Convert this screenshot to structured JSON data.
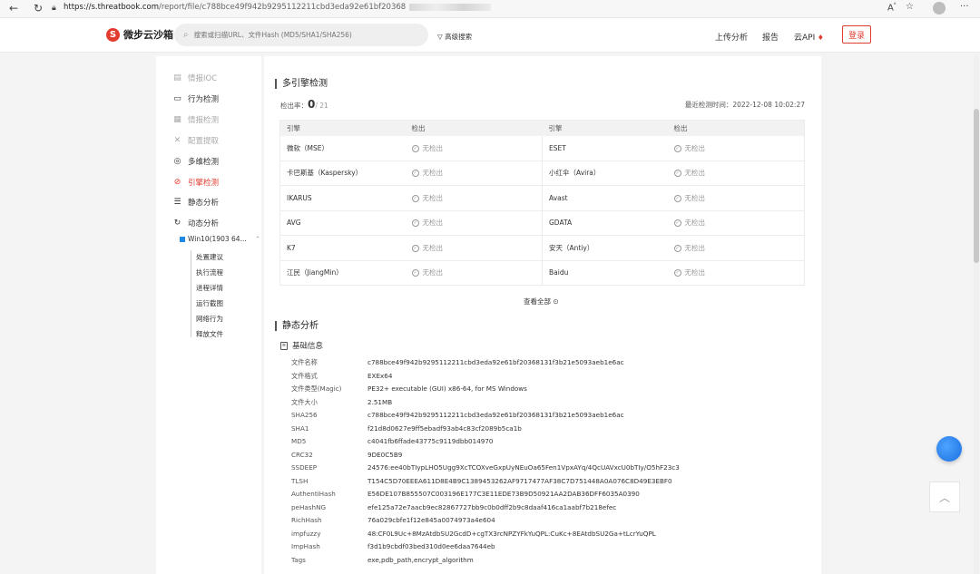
{
  "browser": {
    "back_icon": "back-arrow-icon",
    "refresh_icon": "refresh-icon",
    "url_host": "https://s.threatbook.com",
    "url_path": "/report/file/c788bce49f942b9295112211cbd3eda92e61bf20368",
    "read_aloud": "Aᴬ",
    "more": "···"
  },
  "topnav": {
    "logo_text": "微步云沙箱",
    "search_placeholder": "搜索或扫描URL、文件Hash (MD5/SHA1/SHA256)",
    "advanced_search": "高级搜索",
    "upload_analysis": "上传分析",
    "report": "报告",
    "cloud_api": "云API",
    "login": "登录"
  },
  "sidebar": {
    "items": [
      {
        "label": "情报IOC",
        "icon": "doc-icon"
      },
      {
        "label": "行为检测",
        "icon": "monitor-icon"
      },
      {
        "label": "情报检测",
        "icon": "grid-icon"
      },
      {
        "label": "配置提取",
        "icon": "tools-icon"
      },
      {
        "label": "多维检测",
        "icon": "layers-icon"
      },
      {
        "label": "引擎检测",
        "icon": "question-circle-icon"
      },
      {
        "label": "静态分析",
        "icon": "list-icon"
      },
      {
        "label": "动态分析",
        "icon": "refresh-icon"
      }
    ],
    "env_label": "Win10(1903 64...",
    "sub_items": [
      "处置建议",
      "执行流程",
      "进程详情",
      "运行截图",
      "网络行为",
      "释放文件"
    ]
  },
  "engines": {
    "section_title": "多引擎检测",
    "rate_label": "检出率：",
    "rate_value": "0",
    "rate_total": "/ 21",
    "last_scan": "最近检测时间：2022-12-08 10:02:27",
    "col_engine": "引擎",
    "col_detect": "检出",
    "rows": [
      {
        "e1": "微软（MSE）",
        "d1": "无检出",
        "e2": "ESET",
        "d2": "无检出"
      },
      {
        "e1": "卡巴斯基（Kaspersky）",
        "d1": "无检出",
        "e2": "小红伞（Avira）",
        "d2": "无检出"
      },
      {
        "e1": "IKARUS",
        "d1": "无检出",
        "e2": "Avast",
        "d2": "无检出"
      },
      {
        "e1": "AVG",
        "d1": "无检出",
        "e2": "GDATA",
        "d2": "无检出"
      },
      {
        "e1": "K7",
        "d1": "无检出",
        "e2": "安天（Antiy）",
        "d2": "无检出"
      },
      {
        "e1": "江民（JiangMin）",
        "d1": "无检出",
        "e2": "Baidu",
        "d2": "无检出"
      }
    ],
    "view_all": "查看全部"
  },
  "static": {
    "section_title": "静态分析",
    "basic_info_title": "基础信息",
    "rows": [
      {
        "k": "文件名称",
        "v": "c788bce49f942b9295112211cbd3eda92e61bf20368131f3b21e5093aeb1e6ac"
      },
      {
        "k": "文件格式",
        "v": "EXEx64"
      },
      {
        "k": "文件类型(Magic)",
        "v": "PE32+ executable (GUI) x86-64, for MS Windows"
      },
      {
        "k": "文件大小",
        "v": "2.51MB"
      },
      {
        "k": "SHA256",
        "v": "c788bce49f942b9295112211cbd3eda92e61bf20368131f3b21e5093aeb1e6ac"
      },
      {
        "k": "SHA1",
        "v": "f21d8d0627e9ff5ebadf93ab4c83cf2089b5ca1b"
      },
      {
        "k": "MD5",
        "v": "c4041fb6ffade43775c9119dbb014970"
      },
      {
        "k": "CRC32",
        "v": "9DE0C5B9"
      },
      {
        "k": "SSDEEP",
        "v": "24576:ee40bTIypLHO5Ugg9XcTCOXveGxpUyNEuOa65Fen1VpxAYq/4QcUAVxcU0bTIy/O5hF23c3"
      },
      {
        "k": "TLSH",
        "v": "T154C5D70EEEA611D8E4B9C1389453262AF9717477AF38C7D751448A0A076C8D49E3EBF0"
      },
      {
        "k": "AuthentiHash",
        "v": "E56DE107B855507C003196E177C3E11EDE73B9D50921AA2DAB36DFF6035A0390"
      },
      {
        "k": "peHashNG",
        "v": "efe125a72e7aacb9ec82867727bb9c0b0dff2b9c8daaf416ca1aabf7b218efec"
      },
      {
        "k": "RichHash",
        "v": "76a029cbfe1f12e845a0074973a4e604"
      },
      {
        "k": "impfuzzy",
        "v": "48:CF0L9Uc+8MzAtdbSU2GcdD+cgTX3rcNPZYFkYuQPL:CuKc+8EAtdbSU2Ga+tLcrYuQPL"
      },
      {
        "k": "ImpHash",
        "v": "f3d1b9cbdf03bed310d0ee6daa7644eb"
      },
      {
        "k": "Tags",
        "v": "exe,pdb_path,encrypt_algorithm"
      }
    ]
  }
}
